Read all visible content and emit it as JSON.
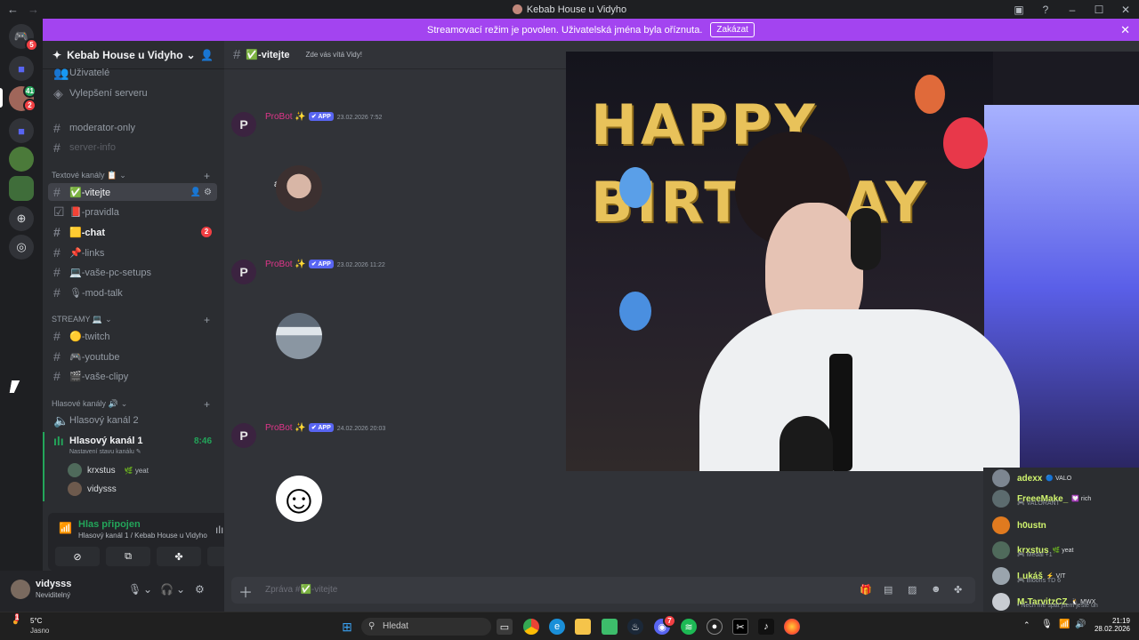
{
  "window": {
    "title": "Kebab House u Vidyho",
    "back": "←",
    "forward": "→",
    "minimize": "–",
    "maximize": "☐",
    "close": "✕"
  },
  "servers": {
    "dm_badge": "5",
    "srv_badge_green": "41",
    "srv_badge_red": "2"
  },
  "banner": {
    "text": "Streamovací režim je povolen. Uživatelská jména byla oříznuta.",
    "button": "Zakázat"
  },
  "sidebar": {
    "server_name": "Kebab House u Vidyho",
    "top_items": [
      "Uživatelé",
      "Vylepšení serveru"
    ],
    "channels_top": [
      "moderator-only",
      "server-info"
    ],
    "text_category": "Textové kanály 📋",
    "text_channels": [
      {
        "name": "✅-vitejte"
      },
      {
        "name": "📕-pravidla"
      },
      {
        "name": "🟨-chat",
        "badge": "2"
      },
      {
        "name": "📌-links"
      },
      {
        "name": "💻-vaše-pc-setups"
      },
      {
        "name": "🎙-mod-talk"
      }
    ],
    "stream_category": "STREAMY 💻",
    "stream_channels": [
      "🟡-twitch",
      "🎮-youtube",
      "🎬-vaše-clipy"
    ],
    "voice_category": "Hlasové kanály 🔊",
    "voice_channels": [
      "Hlasový kanál 2",
      "Hlasový kanál 1"
    ],
    "voice_timer": "8:46",
    "voice_status": "Nastavení stavu kanálu",
    "voice_users": [
      {
        "name": "krxstus",
        "tag": "🌿 yeat"
      },
      {
        "name": "vidysss",
        "tag": ""
      }
    ],
    "voice_panel": {
      "status": "Hlas připojen",
      "location": "Hlasový kanál 1 / Kebab House u Vidyho"
    },
    "user": {
      "name": "vidysss",
      "status": "Neviditelný"
    }
  },
  "chat": {
    "channel": "✅-vitejte",
    "topic": "Zde vás vítá Vidy!",
    "messages": [
      {
        "author": "ProBot ✨",
        "badge": "✔ APP",
        "time": "23.02.2026 7:52",
        "letter": "a"
      },
      {
        "author": "ProBot ✨",
        "badge": "✔ APP",
        "time": "23.02.2026 11:22"
      },
      {
        "author": "ProBot ✨",
        "badge": "✔ APP",
        "time": "24.02.2026 20:03"
      }
    ],
    "input_placeholder": "Zpráva #✅-vitejte"
  },
  "webcam": {
    "balloon_text": "HAPPY BIRTHDAY"
  },
  "members": [
    {
      "name": "adexx",
      "tag": "🔵 VALO",
      "sub": "",
      "color": "#d1f56e"
    },
    {
      "name": "FreeeMake_",
      "tag": "💟 rich",
      "sub": "🎮 VALORANT",
      "color": "#d1f56e"
    },
    {
      "name": "h0ustn",
      "tag": "",
      "sub": "",
      "color": "#d1f56e"
    },
    {
      "name": "krxstus",
      "tag": "🌿 yeat",
      "sub": "🎮 Medal +1",
      "color": "#d1f56e"
    },
    {
      "name": "Lukáš",
      "tag": "⚡ VIT",
      "sub": "🎮 Bloons TD 6",
      "color": "#d1f56e"
    },
    {
      "name": "M-TarvitzCZ",
      "tag": "🐧 MWX",
      "sub": "• Nech mě spát jsem ještě un",
      "color": "#d1f56e"
    }
  ],
  "taskbar": {
    "temp": "5°C",
    "weather": "Jasno",
    "weather_badge": "1",
    "search": "Hledat",
    "time": "21:19",
    "date": "28.02.2026",
    "discord_badge": "7"
  },
  "colors": {
    "banner": "#a344f0",
    "accent_green": "#23a55a",
    "probot": "#e0368a",
    "app_badge": "#5865f2"
  }
}
